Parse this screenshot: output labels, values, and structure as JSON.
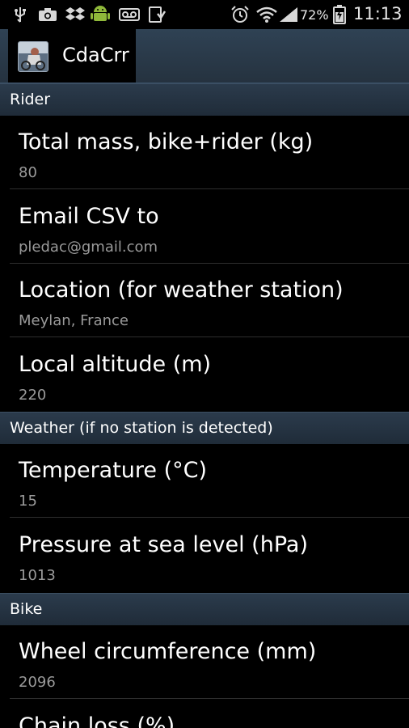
{
  "status_bar": {
    "icons": [
      "usb-icon",
      "camera-icon",
      "dropbox-icon",
      "android-icon",
      "voicemail-icon",
      "download-icon",
      "alarm-icon",
      "wifi-icon",
      "signal-icon",
      "battery-icon"
    ],
    "battery_percent": "72%",
    "time": "11:13"
  },
  "action_bar": {
    "app_name": "CdaCrr"
  },
  "sections": {
    "rider": {
      "header": "Rider",
      "items": [
        {
          "title": "Total mass, bike+rider (kg)",
          "summary": "80"
        },
        {
          "title": "Email CSV to",
          "summary": "pledac@gmail.com"
        },
        {
          "title": "Location (for weather station)",
          "summary": "Meylan, France"
        },
        {
          "title": "Local altitude (m)",
          "summary": "220"
        }
      ]
    },
    "weather": {
      "header": "Weather (if no station is detected)",
      "items": [
        {
          "title": "Temperature (°C)",
          "summary": "15"
        },
        {
          "title": "Pressure at sea level (hPa)",
          "summary": "1013"
        }
      ]
    },
    "bike": {
      "header": "Bike",
      "items": [
        {
          "title": "Wheel circumference (mm)",
          "summary": "2096"
        },
        {
          "title": "Chain loss (%)",
          "summary": ""
        }
      ]
    }
  },
  "colors": {
    "background": "#000000",
    "action_bar": "#29394a",
    "section_header": "#233140",
    "summary_text": "#9a9a9a"
  }
}
